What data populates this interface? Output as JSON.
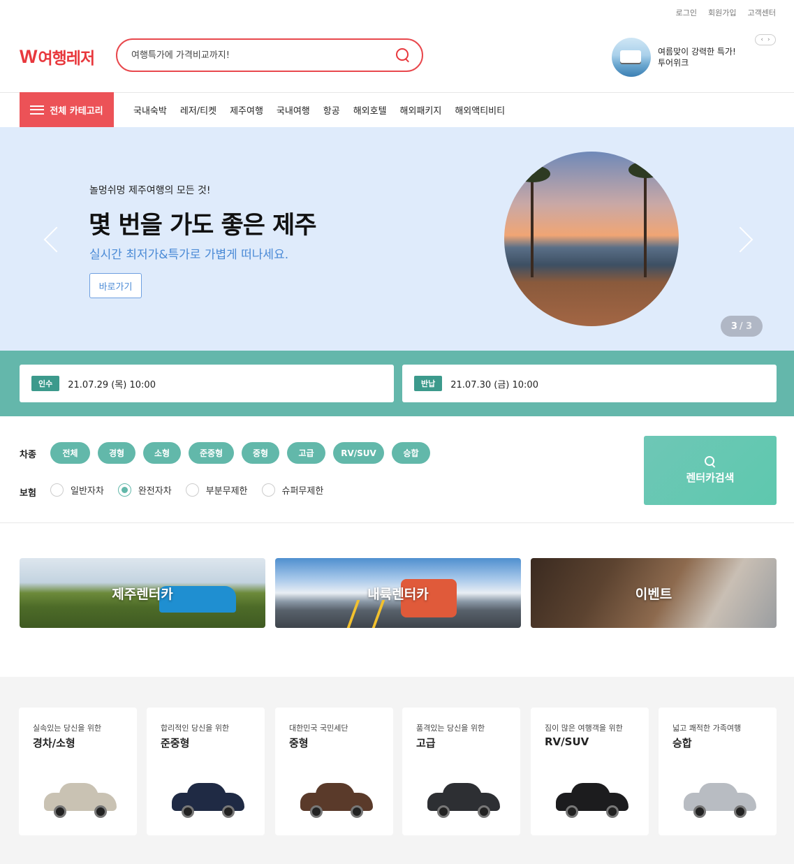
{
  "util_links": [
    "로그인",
    "회원가입",
    "고객센터"
  ],
  "logo": {
    "mark": "W",
    "text": "여행레저"
  },
  "search": {
    "placeholder": "여행특가에 가격비교까지!"
  },
  "promo": {
    "line1": "여름맞이 강력한 특가!",
    "line2": "투어위크"
  },
  "category_button": "전체 카테고리",
  "gnb": [
    "국내숙박",
    "레저/티켓",
    "제주여행",
    "국내여행",
    "항공",
    "해외호텔",
    "해외패키지",
    "해외액티비티"
  ],
  "hero": {
    "sub": "놀멍쉬멍 제주여행의 모든 것!",
    "title": "몇 번을 가도 좋은 제주",
    "desc": "실시간 최저가&특가로 가볍게 떠나세요.",
    "button": "바로가기",
    "current": "3",
    "total": "/ 3"
  },
  "dates": {
    "pickup": {
      "tag": "인수",
      "value": "21.07.29 (목) 10:00"
    },
    "return": {
      "tag": "반납",
      "value": "21.07.30 (금) 10:00"
    }
  },
  "filters": {
    "type_label": "차종",
    "types": [
      "전체",
      "경형",
      "소형",
      "준중형",
      "중형",
      "고급",
      "RV/SUV",
      "승합"
    ],
    "insurance_label": "보험",
    "insurance": [
      {
        "label": "일반자차",
        "selected": false
      },
      {
        "label": "완전자차",
        "selected": true
      },
      {
        "label": "부분무제한",
        "selected": false
      },
      {
        "label": "슈퍼무제한",
        "selected": false
      }
    ],
    "search_button": "렌터카검색"
  },
  "banners": [
    "제주렌터카",
    "내륙렌터카",
    "이벤트"
  ],
  "car_classes": [
    {
      "sub": "실속있는 당신을 위한",
      "name": "경차/소형",
      "color": "#c9c2b3"
    },
    {
      "sub": "합리적인 당신을 위한",
      "name": "준중형",
      "color": "#1f2a44"
    },
    {
      "sub": "대한민국 국민세단",
      "name": "중형",
      "color": "#5a3a2a"
    },
    {
      "sub": "품격있는 당신을 위한",
      "name": "고급",
      "color": "#2d2f33"
    },
    {
      "sub": "짐이 많은 여행객을 위한",
      "name": "RV/SUV",
      "color": "#1c1c1e"
    },
    {
      "sub": "넓고 쾌적한 가족여행",
      "name": "승합",
      "color": "#b8bcc2"
    }
  ]
}
